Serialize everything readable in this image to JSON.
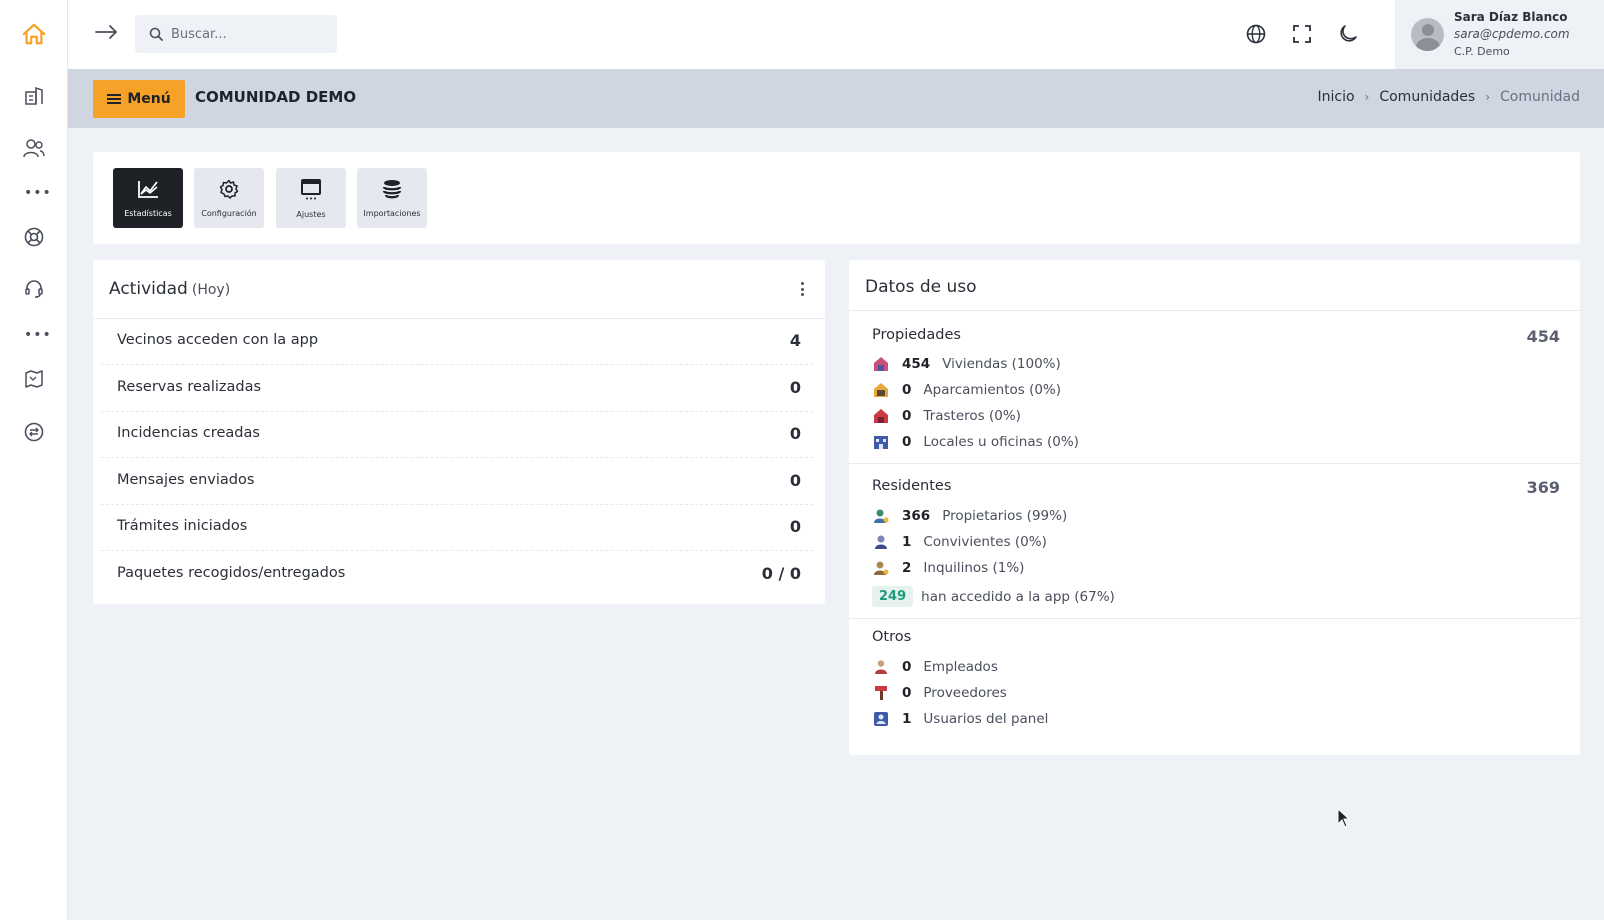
{
  "sidebar": {
    "items": [
      {
        "name": "home-icon",
        "color": "#f6a229"
      },
      {
        "name": "building-icon"
      },
      {
        "name": "users-icon"
      },
      {
        "name": "more-icon"
      },
      {
        "name": "lifebuoy-icon"
      },
      {
        "name": "headset-icon"
      },
      {
        "name": "more-icon"
      },
      {
        "name": "map-icon"
      },
      {
        "name": "transfer-icon"
      }
    ]
  },
  "topbar": {
    "search_placeholder": "Buscar...",
    "icons": [
      "arrow-right-icon",
      "globe-icon",
      "fullscreen-icon",
      "moon-icon"
    ]
  },
  "user": {
    "name": "Sara Díaz Blanco",
    "email": "sara@cpdemo.com",
    "org": "C.P. Demo"
  },
  "header": {
    "menu_label": "Menú",
    "title": "COMUNIDAD DEMO",
    "breadcrumb": [
      "Inicio",
      "Comunidades",
      "Comunidad"
    ]
  },
  "tools": [
    {
      "label": "Estadísticas",
      "icon": "chart-icon",
      "active": true
    },
    {
      "label": "Configuración",
      "icon": "gear-icon",
      "active": false
    },
    {
      "label": "Ajustes",
      "icon": "window-icon",
      "active": false
    },
    {
      "label": "Importaciones",
      "icon": "database-icon",
      "active": false
    }
  ],
  "activity": {
    "title": "Actividad",
    "subtitle": "(Hoy)",
    "rows": [
      {
        "label": "Vecinos acceden con la app",
        "value": "4"
      },
      {
        "label": "Reservas realizadas",
        "value": "0"
      },
      {
        "label": "Incidencias creadas",
        "value": "0"
      },
      {
        "label": "Mensajes enviados",
        "value": "0"
      },
      {
        "label": "Trámites iniciados",
        "value": "0"
      },
      {
        "label": "Paquetes recogidos/entregados",
        "value": "0 / 0"
      }
    ]
  },
  "usage": {
    "title": "Datos de uso",
    "propiedades": {
      "title": "Propiedades",
      "total": "454",
      "rows": [
        {
          "num": "454",
          "text": "Viviendas (100%)",
          "icon": "house-icon"
        },
        {
          "num": "0",
          "text": "Aparcamientos (0%)",
          "icon": "parking-icon"
        },
        {
          "num": "0",
          "text": "Trasteros (0%)",
          "icon": "storage-icon"
        },
        {
          "num": "0",
          "text": "Locales u oficinas (0%)",
          "icon": "office-icon"
        }
      ]
    },
    "residentes": {
      "title": "Residentes",
      "total": "369",
      "rows": [
        {
          "num": "366",
          "text": "Propietarios (99%)",
          "icon": "owner-icon"
        },
        {
          "num": "1",
          "text": "Convivientes (0%)",
          "icon": "cohabitant-icon"
        },
        {
          "num": "2",
          "text": "Inquilinos (1%)",
          "icon": "tenant-icon"
        }
      ],
      "app_count": "249",
      "app_text": "han accedido a la app (67%)"
    },
    "otros": {
      "title": "Otros",
      "rows": [
        {
          "num": "0",
          "text": "Empleados",
          "icon": "employee-icon"
        },
        {
          "num": "0",
          "text": "Proveedores",
          "icon": "provider-icon"
        },
        {
          "num": "1",
          "text": "Usuarios del panel",
          "icon": "panel-user-icon"
        }
      ]
    }
  },
  "colors": {
    "accent": "#f6a229",
    "dark": "#1e2126",
    "teal": "#1d9a7e"
  }
}
